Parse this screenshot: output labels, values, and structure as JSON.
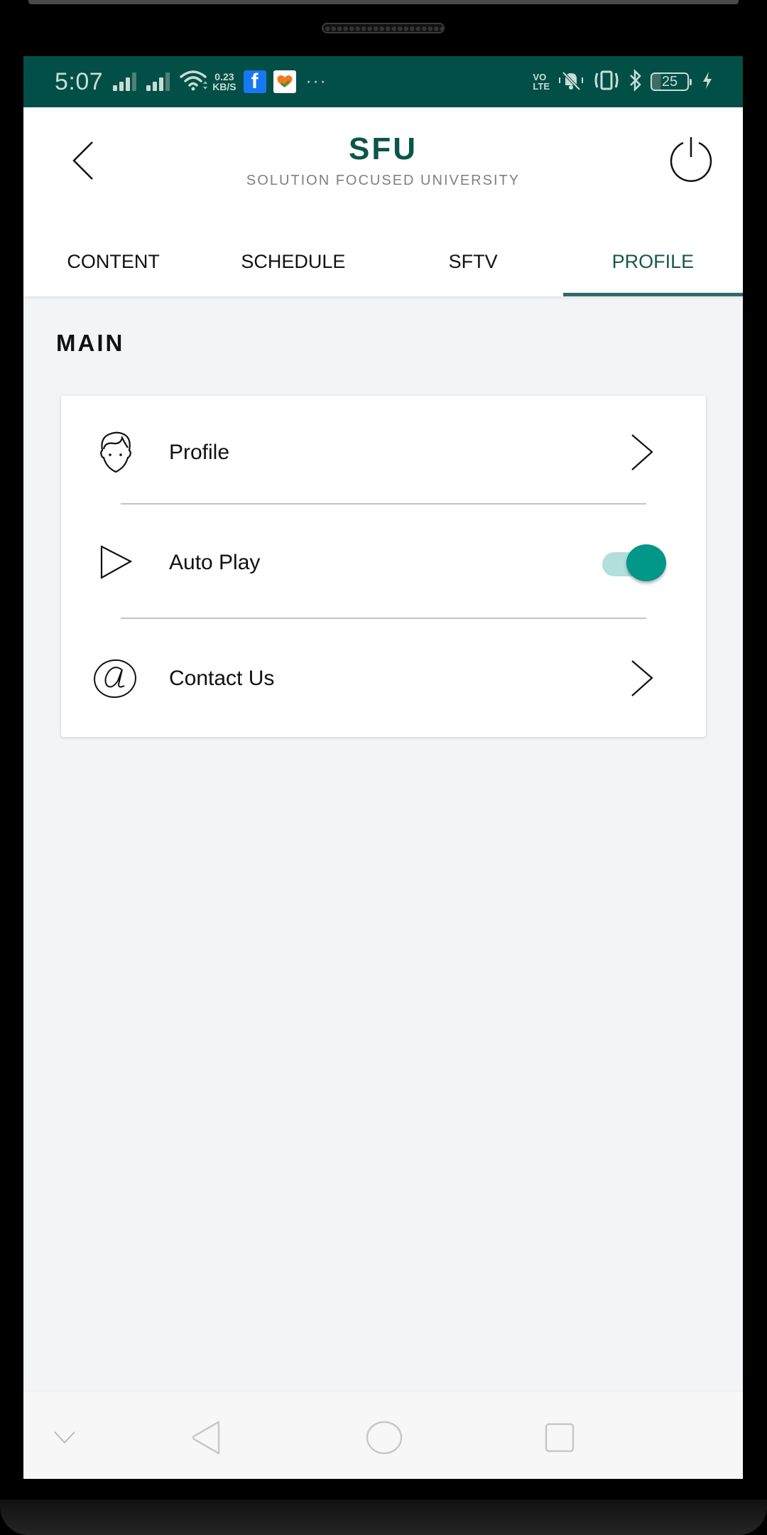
{
  "status_bar": {
    "time": "5:07",
    "network_speed_value": "0.23",
    "network_speed_unit": "KB/S",
    "volte_top": "VO",
    "volte_bottom": "LTE",
    "battery_level": "25",
    "notification_more": "···",
    "facebook_glyph": "f"
  },
  "header": {
    "title": "SFU",
    "subtitle": "SOLUTION FOCUSED UNIVERSITY"
  },
  "tabs": [
    {
      "label": "CONTENT",
      "active": false
    },
    {
      "label": "SCHEDULE",
      "active": false
    },
    {
      "label": "SFTV",
      "active": false
    },
    {
      "label": "PROFILE",
      "active": true
    }
  ],
  "main": {
    "section_title": "MAIN",
    "items": [
      {
        "label": "Profile",
        "icon": "face-icon",
        "action": "chevron"
      },
      {
        "label": "Auto Play",
        "icon": "play-icon",
        "action": "toggle",
        "toggle_on": true
      },
      {
        "label": "Contact Us",
        "icon": "at-icon",
        "action": "chevron"
      }
    ]
  },
  "colors": {
    "brand": "#0b5549",
    "status_bar": "#024f47",
    "accent": "#009688",
    "tab_indicator": "#2d6b68"
  }
}
